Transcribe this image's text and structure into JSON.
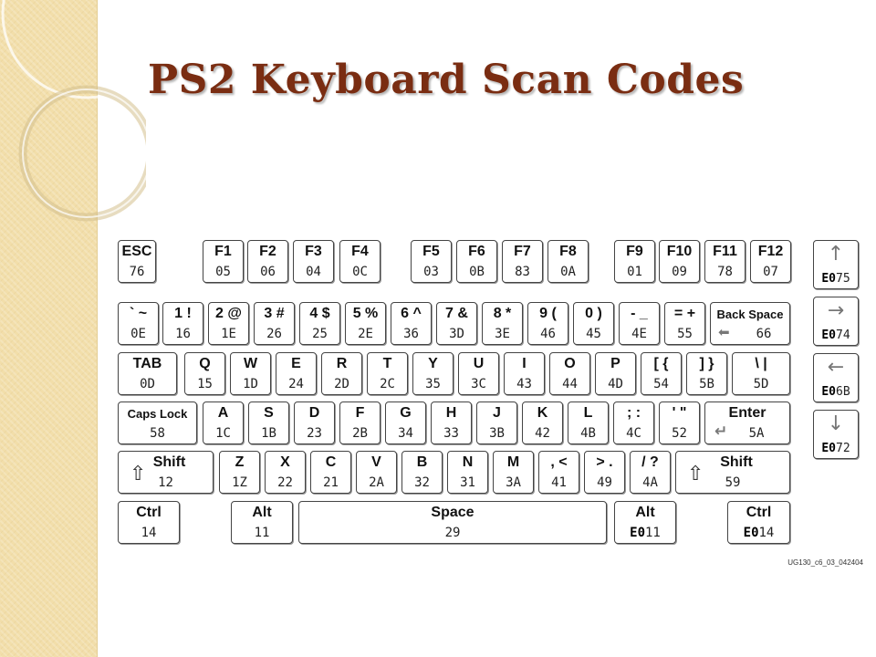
{
  "slide": {
    "title": "PS2 Keyboard Scan Codes",
    "footnote": "UG130_c6_03_042404"
  },
  "keyboard": {
    "row_function": [
      {
        "name": "esc",
        "label": "ESC",
        "code": "76"
      },
      {
        "name": "f1",
        "label": "F1",
        "code": "05"
      },
      {
        "name": "f2",
        "label": "F2",
        "code": "06"
      },
      {
        "name": "f3",
        "label": "F3",
        "code": "04"
      },
      {
        "name": "f4",
        "label": "F4",
        "code": "0C"
      },
      {
        "name": "f5",
        "label": "F5",
        "code": "03"
      },
      {
        "name": "f6",
        "label": "F6",
        "code": "0B"
      },
      {
        "name": "f7",
        "label": "F7",
        "code": "83"
      },
      {
        "name": "f8",
        "label": "F8",
        "code": "0A"
      },
      {
        "name": "f9",
        "label": "F9",
        "code": "01"
      },
      {
        "name": "f10",
        "label": "F10",
        "code": "09"
      },
      {
        "name": "f11",
        "label": "F11",
        "code": "78"
      },
      {
        "name": "f12",
        "label": "F12",
        "code": "07"
      }
    ],
    "row_number": [
      {
        "name": "backtick",
        "label": "` ~",
        "code": "0E"
      },
      {
        "name": "1",
        "label": "1 !",
        "code": "16"
      },
      {
        "name": "2",
        "label": "2 @",
        "code": "1E"
      },
      {
        "name": "3",
        "label": "3 #",
        "code": "26"
      },
      {
        "name": "4",
        "label": "4 $",
        "code": "25"
      },
      {
        "name": "5",
        "label": "5 %",
        "code": "2E"
      },
      {
        "name": "6",
        "label": "6 ^",
        "code": "36"
      },
      {
        "name": "7",
        "label": "7 &",
        "code": "3D"
      },
      {
        "name": "8",
        "label": "8 *",
        "code": "3E"
      },
      {
        "name": "9",
        "label": "9 (",
        "code": "46"
      },
      {
        "name": "0",
        "label": "0 )",
        "code": "45"
      },
      {
        "name": "minus",
        "label": "- _",
        "code": "4E"
      },
      {
        "name": "equals",
        "label": "= +",
        "code": "55"
      },
      {
        "name": "backspace",
        "label": "Back Space",
        "code": "66"
      }
    ],
    "row_qwerty": [
      {
        "name": "tab",
        "label": "TAB",
        "code": "0D"
      },
      {
        "name": "q",
        "label": "Q",
        "code": "15"
      },
      {
        "name": "w",
        "label": "W",
        "code": "1D"
      },
      {
        "name": "e",
        "label": "E",
        "code": "24"
      },
      {
        "name": "r",
        "label": "R",
        "code": "2D"
      },
      {
        "name": "t",
        "label": "T",
        "code": "2C"
      },
      {
        "name": "y",
        "label": "Y",
        "code": "35"
      },
      {
        "name": "u",
        "label": "U",
        "code": "3C"
      },
      {
        "name": "i",
        "label": "I",
        "code": "43"
      },
      {
        "name": "o",
        "label": "O",
        "code": "44"
      },
      {
        "name": "p",
        "label": "P",
        "code": "4D"
      },
      {
        "name": "lbracket",
        "label": "[ {",
        "code": "54"
      },
      {
        "name": "rbracket",
        "label": "] }",
        "code": "5B"
      },
      {
        "name": "backslash",
        "label": "\\ |",
        "code": "5D"
      }
    ],
    "row_home": [
      {
        "name": "capslock",
        "label": "Caps Lock",
        "code": "58"
      },
      {
        "name": "a",
        "label": "A",
        "code": "1C"
      },
      {
        "name": "s",
        "label": "S",
        "code": "1B"
      },
      {
        "name": "d",
        "label": "D",
        "code": "23"
      },
      {
        "name": "f",
        "label": "F",
        "code": "2B"
      },
      {
        "name": "g",
        "label": "G",
        "code": "34"
      },
      {
        "name": "h",
        "label": "H",
        "code": "33"
      },
      {
        "name": "j",
        "label": "J",
        "code": "3B"
      },
      {
        "name": "k",
        "label": "K",
        "code": "42"
      },
      {
        "name": "l",
        "label": "L",
        "code": "4B"
      },
      {
        "name": "semicolon",
        "label": "; :",
        "code": "4C"
      },
      {
        "name": "quote",
        "label": "' \"",
        "code": "52"
      },
      {
        "name": "enter",
        "label": "Enter",
        "code": "5A"
      }
    ],
    "row_bottom": [
      {
        "name": "lshift",
        "label": "Shift",
        "code": "12"
      },
      {
        "name": "z",
        "label": "Z",
        "code": "1Z"
      },
      {
        "name": "x",
        "label": "X",
        "code": "22"
      },
      {
        "name": "c",
        "label": "C",
        "code": "21"
      },
      {
        "name": "v",
        "label": "V",
        "code": "2A"
      },
      {
        "name": "b",
        "label": "B",
        "code": "32"
      },
      {
        "name": "n",
        "label": "N",
        "code": "31"
      },
      {
        "name": "m",
        "label": "M",
        "code": "3A"
      },
      {
        "name": "comma",
        "label": ", <",
        "code": "41"
      },
      {
        "name": "period",
        "label": "> .",
        "code": "49"
      },
      {
        "name": "slash",
        "label": "/ ?",
        "code": "4A"
      },
      {
        "name": "rshift",
        "label": "Shift",
        "code": "59"
      }
    ],
    "row_space": [
      {
        "name": "lctrl",
        "label": "Ctrl",
        "code": "14"
      },
      {
        "name": "lalt",
        "label": "Alt",
        "code": "11"
      },
      {
        "name": "space",
        "label": "Space",
        "code": "29"
      },
      {
        "name": "ralt",
        "label": "Alt",
        "prefix": "E0",
        "code": "11"
      },
      {
        "name": "rctrl",
        "label": "Ctrl",
        "prefix": "E0",
        "code": "14"
      }
    ],
    "arrows": [
      {
        "name": "up",
        "icon": "arrow-up-icon",
        "prefix": "E0",
        "code": "75"
      },
      {
        "name": "right",
        "icon": "arrow-right-icon",
        "prefix": "E0",
        "code": "74"
      },
      {
        "name": "left",
        "icon": "arrow-left-icon",
        "prefix": "E0",
        "code": "6B"
      },
      {
        "name": "down",
        "icon": "arrow-down-icon",
        "prefix": "E0",
        "code": "72"
      }
    ]
  },
  "colors": {
    "title": "#7a2d12",
    "side_band": "#f2deaa",
    "key_border": "#444444"
  }
}
